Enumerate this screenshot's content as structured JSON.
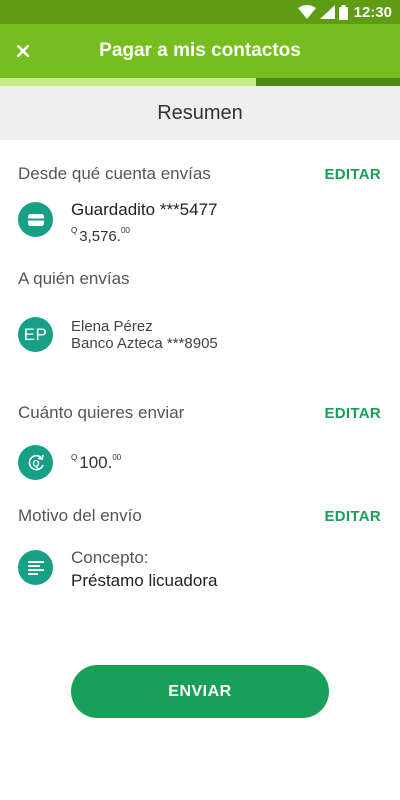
{
  "status_bar": {
    "time": "12:30"
  },
  "app_bar": {
    "title": "Pagar a mis contactos"
  },
  "progress": {
    "fraction": 0.64
  },
  "summary": {
    "title": "Resumen"
  },
  "account_section": {
    "label": "Desde qué cuenta envías",
    "edit_label": "EDITAR",
    "account_name": "Guardadito ***5477",
    "currency_symbol": "Q",
    "balance_main": "3,576.",
    "balance_cents": "00",
    "icon": "card-icon"
  },
  "recipient_section": {
    "label": "A quién envías",
    "initials": "EP",
    "name": "Elena Pérez",
    "bank": "Banco Azteca ***8905"
  },
  "amount_section": {
    "label": "Cuánto quieres enviar",
    "edit_label": "EDITAR",
    "currency_symbol": "Q",
    "amount_main": "100.",
    "amount_cents": "00",
    "icon": "currency-cycle-icon"
  },
  "reason_section": {
    "label": "Motivo del envío",
    "edit_label": "EDITAR",
    "concept_label": "Concepto:",
    "concept_value": "Préstamo licuadora",
    "icon": "text-lines-icon"
  },
  "send_button": {
    "label": "ENVIAR"
  },
  "colors": {
    "status_bar": "#5d9c13",
    "app_bar": "#76bd1f",
    "accent": "#18a058",
    "icon_circle": "#16a085",
    "progress_fill": "#c5eb8a",
    "progress_track": "#4e8a10"
  }
}
